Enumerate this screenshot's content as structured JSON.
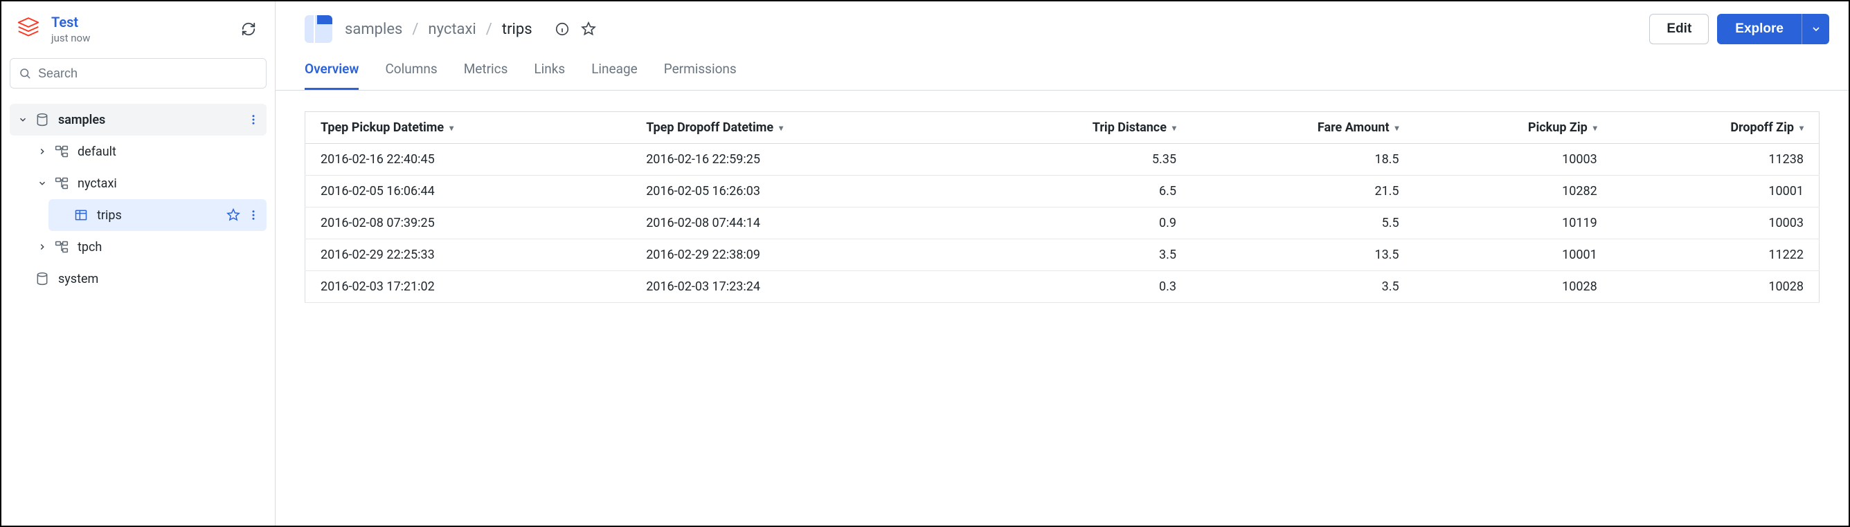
{
  "sidebar": {
    "brand_title": "Test",
    "brand_subtitle": "just now",
    "search_placeholder": "Search",
    "tree": {
      "samples": {
        "label": "samples"
      },
      "default": {
        "label": "default"
      },
      "nyctaxi": {
        "label": "nyctaxi"
      },
      "trips": {
        "label": "trips"
      },
      "tpch": {
        "label": "tpch"
      },
      "system": {
        "label": "system"
      }
    }
  },
  "header": {
    "crumbs": {
      "c0": "samples",
      "c1": "nyctaxi",
      "c2": "trips"
    },
    "edit_label": "Edit",
    "explore_label": "Explore"
  },
  "tabs": {
    "overview": "Overview",
    "columns": "Columns",
    "metrics": "Metrics",
    "links": "Links",
    "lineage": "Lineage",
    "permissions": "Permissions"
  },
  "table": {
    "headers": {
      "pickup": "Tpep Pickup Datetime",
      "dropoff": "Tpep Dropoff Datetime",
      "dist": "Trip Distance",
      "fare": "Fare Amount",
      "pzip": "Pickup Zip",
      "dzip": "Dropoff Zip"
    },
    "rows": [
      {
        "pickup": "2016-02-16 22:40:45",
        "dropoff": "2016-02-16 22:59:25",
        "dist": "5.35",
        "fare": "18.5",
        "pzip": "10003",
        "dzip": "11238"
      },
      {
        "pickup": "2016-02-05 16:06:44",
        "dropoff": "2016-02-05 16:26:03",
        "dist": "6.5",
        "fare": "21.5",
        "pzip": "10282",
        "dzip": "10001"
      },
      {
        "pickup": "2016-02-08 07:39:25",
        "dropoff": "2016-02-08 07:44:14",
        "dist": "0.9",
        "fare": "5.5",
        "pzip": "10119",
        "dzip": "10003"
      },
      {
        "pickup": "2016-02-29 22:25:33",
        "dropoff": "2016-02-29 22:38:09",
        "dist": "3.5",
        "fare": "13.5",
        "pzip": "10001",
        "dzip": "11222"
      },
      {
        "pickup": "2016-02-03 17:21:02",
        "dropoff": "2016-02-03 17:23:24",
        "dist": "0.3",
        "fare": "3.5",
        "pzip": "10028",
        "dzip": "10028"
      }
    ]
  }
}
